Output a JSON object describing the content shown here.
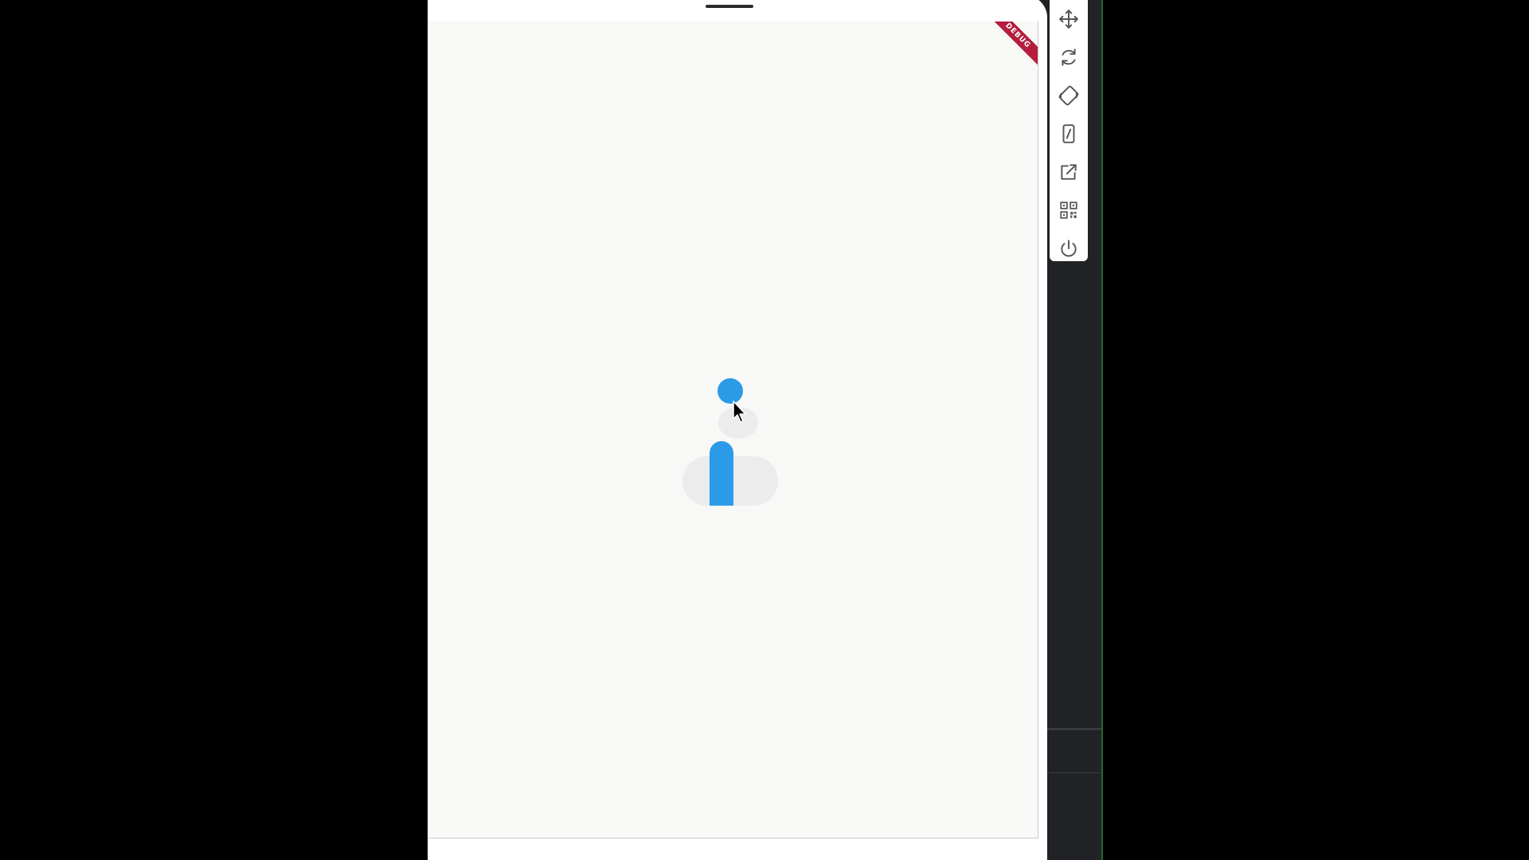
{
  "device": {
    "debug_banner": "DEBUG"
  },
  "toolbar": {
    "tools": [
      {
        "name": "move",
        "icon": "move-icon"
      },
      {
        "name": "rotate",
        "icon": "rotate-icon"
      },
      {
        "name": "rotate-screen",
        "icon": "screen-rotation-icon"
      },
      {
        "name": "device",
        "icon": "phone-icon"
      },
      {
        "name": "open-external",
        "icon": "open-external-icon"
      },
      {
        "name": "qr-code",
        "icon": "qr-code-icon"
      },
      {
        "name": "power",
        "icon": "power-icon"
      }
    ]
  },
  "colors": {
    "accent": "#2b9be8",
    "track": "#ececec",
    "screen_bg": "#f8f8f7",
    "debug_banner": "#b41d3d",
    "ide_bg": "#212226"
  }
}
